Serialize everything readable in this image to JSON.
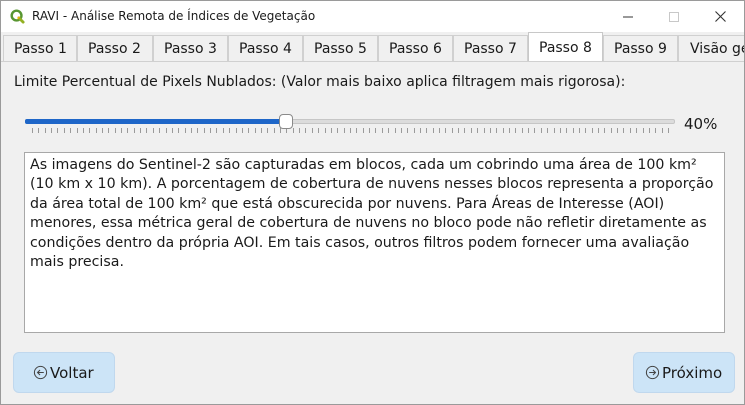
{
  "window": {
    "title": "RAVI - Análise Remota de Índices de Vegetação",
    "app_icon": "qgis-logo-icon",
    "controls": [
      "minimize-icon",
      "maximize-icon",
      "close-icon"
    ]
  },
  "tabs": [
    {
      "label": "Passo 1",
      "active": false
    },
    {
      "label": "Passo 2",
      "active": false
    },
    {
      "label": "Passo 3",
      "active": false
    },
    {
      "label": "Passo 4",
      "active": false
    },
    {
      "label": "Passo 5",
      "active": false
    },
    {
      "label": "Passo 6",
      "active": false
    },
    {
      "label": "Passo 7",
      "active": false
    },
    {
      "label": "Passo 8",
      "active": true
    },
    {
      "label": "Passo 9",
      "active": false
    },
    {
      "label": "Visão ge",
      "active": false
    }
  ],
  "cloud_filter": {
    "label": "Limite Percentual de Pixels Nublados: (Valor mais baixo aplica filtragem mais rigorosa):",
    "value_percent": 40,
    "value_text": "40%",
    "min": 0,
    "max": 100,
    "accent_color": "#1e66c8"
  },
  "description": "As imagens do Sentinel-2 são capturadas em blocos, cada um cobrindo uma área de 100 km² (10 km x 10 km). A porcentagem de cobertura de nuvens nesses blocos representa a proporção da área total de 100 km² que está obscurecida por nuvens. Para Áreas de Interesse (AOI) menores, essa métrica geral de cobertura de nuvens no bloco pode não refletir diretamente as condições dentro da própria AOI. Em tais casos, outros filtros podem fornecer uma avaliação mais precisa.",
  "footer": {
    "back_label": "Voltar",
    "back_icon": "arrow-left-circle-icon",
    "next_label": "Próximo",
    "next_icon": "arrow-right-circle-icon",
    "button_color": "#cce4f7"
  }
}
